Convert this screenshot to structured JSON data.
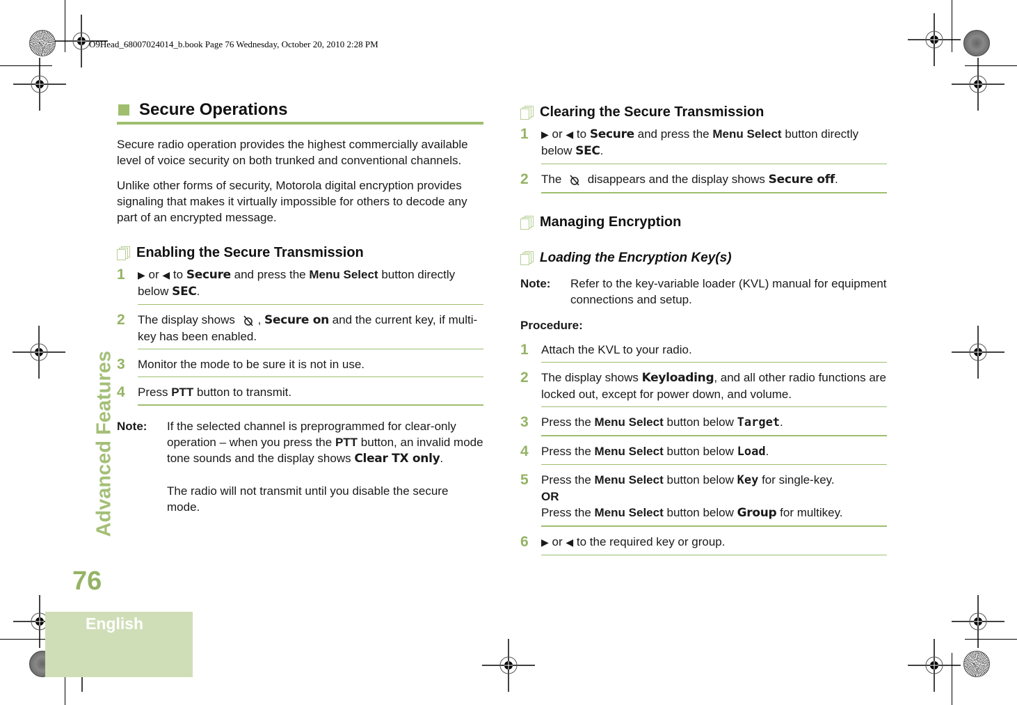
{
  "print_header": "O9Head_68007024014_b.book  Page 76  Wednesday, October 20, 2010  2:28 PM",
  "sidebar": {
    "section_title": "Advanced Features",
    "page_number": "76",
    "language": "English"
  },
  "colors": {
    "accent": "#9fbe6e",
    "accent_dark": "#94b365",
    "tab_bg": "#d0deb8"
  },
  "left": {
    "heading": "Secure Operations",
    "para1": "Secure radio operation provides the highest commercially available level of voice security on both trunked and conventional channels.",
    "para2": "Unlike other forms of security, Motorola digital encryption provides signaling that makes it virtually impossible for others to decode any part of an encrypted message.",
    "subheading": "Enabling the Secure Transmission",
    "steps": [
      {
        "num": "1",
        "a": "or",
        "b": "to",
        "c": "Secure",
        "d": "and press the",
        "e": "Menu Select",
        "f": "button directly below",
        "g": "SEC",
        "h": "."
      },
      {
        "num": "2",
        "a": "The display shows",
        "b": ",",
        "c": "Secure on",
        "d": "and the current key, if multi-key has been enabled."
      },
      {
        "num": "3",
        "a": "Monitor the mode to be sure it is not in use."
      },
      {
        "num": "4",
        "a": "Press",
        "b": "PTT",
        "c": "button to transmit."
      }
    ],
    "note": {
      "label": "Note:",
      "t1": "If the selected channel is preprogrammed for clear-only operation – when you press the",
      "t2": "PTT",
      "t3": "button, an invalid mode tone sounds and the display shows",
      "t4": "Clear TX only",
      "t5": ".",
      "t6": "The radio will not transmit until you disable the secure mode."
    }
  },
  "right": {
    "clear_heading": "Clearing the Secure Transmission",
    "clear_steps": [
      {
        "num": "1",
        "a": "or",
        "b": "to",
        "c": "Secure",
        "d": "and press the",
        "e": "Menu Select",
        "f": "button directly below",
        "g": "SEC",
        "h": "."
      },
      {
        "num": "2",
        "a": "The",
        "b": "disappears and the display shows",
        "c": "Secure off",
        "d": "."
      }
    ],
    "managing_heading": "Managing Encryption",
    "loading_heading": "Loading the Encryption Key(s)",
    "note": {
      "label": "Note:",
      "text": "Refer to the key-variable loader (KVL) manual for equipment connections and setup."
    },
    "procedure_label": "Procedure:",
    "load_steps": [
      {
        "num": "1",
        "a": "Attach the KVL to your radio."
      },
      {
        "num": "2",
        "a": "The display shows",
        "b": "Keyloading",
        "c": ", and all other radio functions are locked out, except for power down, and volume."
      },
      {
        "num": "3",
        "a": "Press the",
        "b": "Menu Select",
        "c": "button below",
        "d": "Target",
        "e": "."
      },
      {
        "num": "4",
        "a": "Press the",
        "b": "Menu Select",
        "c": "button below",
        "d": "Load",
        "e": "."
      },
      {
        "num": "5",
        "a": "Press the",
        "b": "Menu Select",
        "c": "button below",
        "d": "Key",
        "e": "for single-key.",
        "or": "OR",
        "f": "Press the",
        "g": "Menu Select",
        "h": "button below",
        "i": "Group",
        "j": "for multikey."
      },
      {
        "num": "6",
        "a": "or",
        "b": "to the required key or group."
      }
    ]
  }
}
